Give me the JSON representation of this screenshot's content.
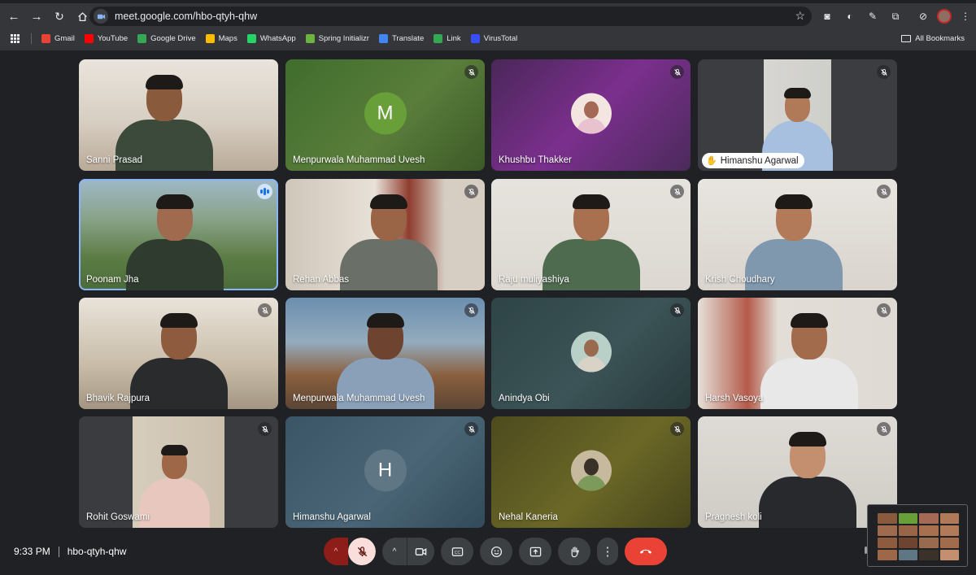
{
  "browser": {
    "url": "meet.google.com/hbo-qtyh-qhw",
    "bookmarks": [
      {
        "label": "Gmail",
        "color": "#ea4335"
      },
      {
        "label": "YouTube",
        "color": "#ff0000"
      },
      {
        "label": "Google Drive",
        "color": "#34a853"
      },
      {
        "label": "Maps",
        "color": "#fbbc04"
      },
      {
        "label": "WhatsApp",
        "color": "#25d366"
      },
      {
        "label": "Spring Initializr",
        "color": "#6db33f"
      },
      {
        "label": "Translate",
        "color": "#4285f4"
      },
      {
        "label": "Link",
        "color": "#34a853"
      },
      {
        "label": "VirusTotal",
        "color": "#394eff"
      }
    ],
    "all_bookmarks": "All Bookmarks"
  },
  "participants": [
    {
      "name": "Sanni Prasad",
      "type": "video",
      "muted": false
    },
    {
      "name": "Menpurwala Muhammad Uvesh",
      "type": "letter",
      "letter": "M",
      "muted": true
    },
    {
      "name": "Khushbu Thakker",
      "type": "photo",
      "muted": true
    },
    {
      "name": "Himanshu Agarwal",
      "type": "video",
      "muted": true,
      "hand_raised": true
    },
    {
      "name": "Poonam Jha",
      "type": "video",
      "speaking": true
    },
    {
      "name": "Rehan Abbas",
      "type": "video",
      "muted": true
    },
    {
      "name": "Raju muliyashiya",
      "type": "video",
      "muted": true
    },
    {
      "name": "Krish Choudhary",
      "type": "video",
      "muted": true
    },
    {
      "name": "Bhavik Rajpura",
      "type": "video",
      "muted": true
    },
    {
      "name": "Menpurwala Muhammad Uvesh",
      "type": "video",
      "muted": true
    },
    {
      "name": "Anindya Obi",
      "type": "photo",
      "muted": true
    },
    {
      "name": "Harsh Vasoya",
      "type": "video",
      "muted": true
    },
    {
      "name": "Rohit Goswami",
      "type": "video",
      "muted": true
    },
    {
      "name": "Himanshu Agarwal",
      "type": "letter",
      "letter": "H",
      "muted": true
    },
    {
      "name": "Nehal Kaneria",
      "type": "photo",
      "muted": true
    },
    {
      "name": "Pragnesh koli",
      "type": "video",
      "muted": true
    }
  ],
  "meeting": {
    "time": "9:33 PM",
    "code": "hbo-qtyh-qhw"
  },
  "colors": {
    "accent": "#8ab4f8",
    "leave": "#ea4335",
    "mic_off_bg": "#f9dedc"
  }
}
